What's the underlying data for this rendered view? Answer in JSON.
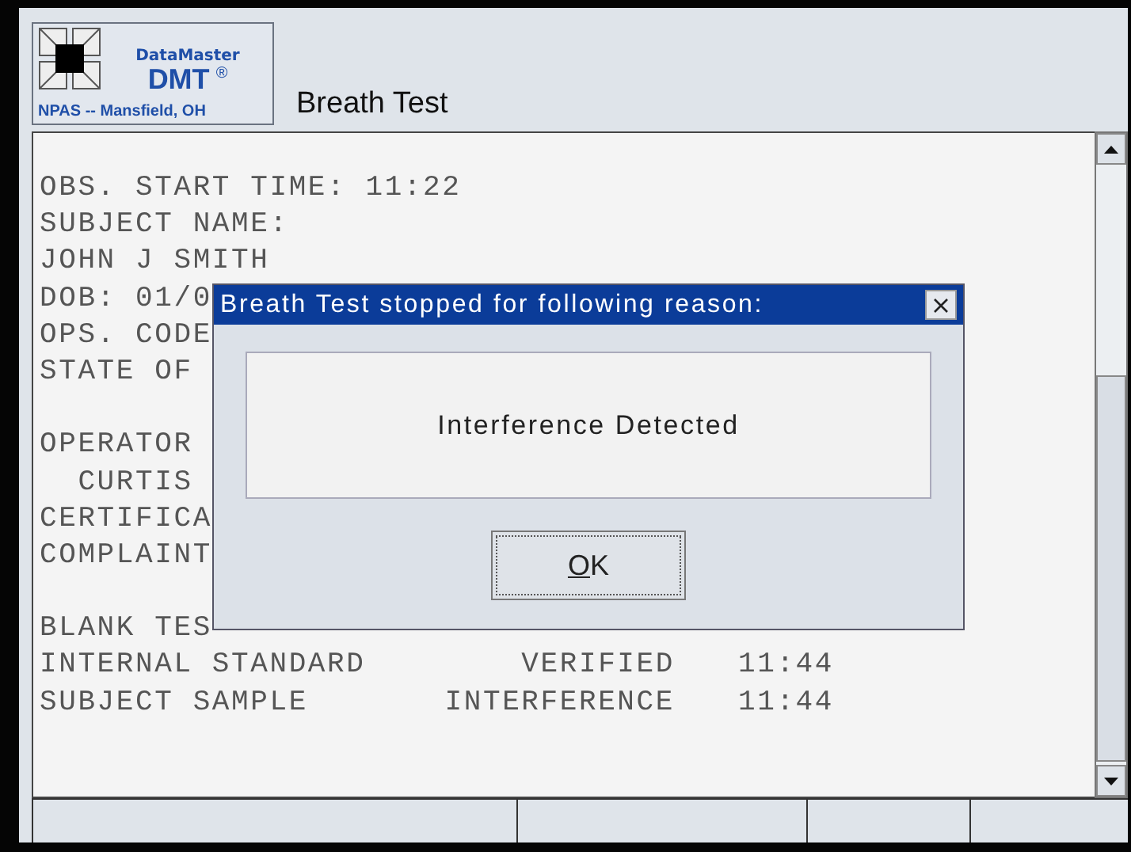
{
  "header": {
    "logo": {
      "brand": "DataMaster",
      "model": "DMT",
      "mark": "®",
      "location": "NPAS -- Mansfield, OH"
    },
    "title": "Breath Test"
  },
  "report": {
    "lines": [
      {
        "kind": "text",
        "text": "OBS. START TIME: 11:22"
      },
      {
        "kind": "text",
        "text": "SUBJECT NAME:"
      },
      {
        "kind": "text",
        "text": "JOHN J SMITH"
      },
      {
        "kind": "text",
        "text": "DOB: 01/0"
      },
      {
        "kind": "text",
        "text": "OPS. CODE"
      },
      {
        "kind": "text",
        "text": "STATE OF"
      },
      {
        "kind": "blank"
      },
      {
        "kind": "text",
        "text": "OPERATOR"
      },
      {
        "kind": "text",
        "text": "  CURTIS"
      },
      {
        "kind": "text",
        "text": "CERTIFICA"
      },
      {
        "kind": "text",
        "text": "COMPLAINT"
      },
      {
        "kind": "blank"
      },
      {
        "kind": "text",
        "text": "BLANK TES"
      },
      {
        "kind": "result",
        "label": "INTERNAL STANDARD",
        "value": "VERIFIED",
        "time": "11:44"
      },
      {
        "kind": "result",
        "label": "SUBJECT SAMPLE",
        "value": "INTERFERENCE",
        "time": "11:44"
      }
    ]
  },
  "dialog": {
    "title": "Breath Test stopped for following reason:",
    "message": "Interference Detected",
    "button": "OK"
  }
}
